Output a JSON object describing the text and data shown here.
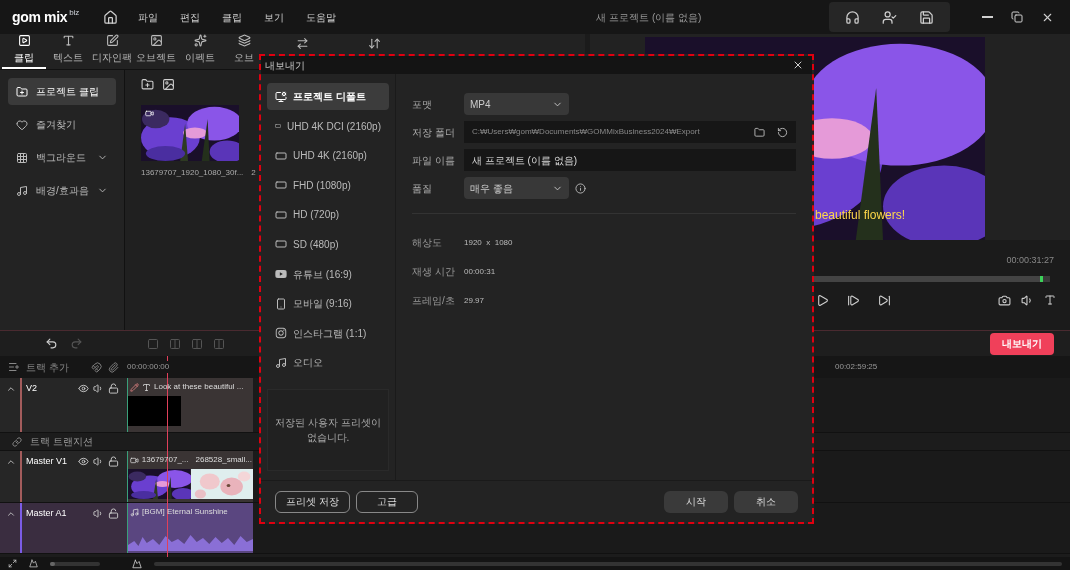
{
  "app": {
    "logo": "gom mix",
    "logo_sup": "biz",
    "menu": [
      "파일",
      "편집",
      "클립",
      "보기",
      "도움말"
    ],
    "title": "새 프로젝트 (이름 없음)"
  },
  "tool_tabs": [
    {
      "label": "클립",
      "kind": "clip",
      "selected": true
    },
    {
      "label": "텍스트",
      "kind": "text",
      "selected": false
    },
    {
      "label": "디자인팩",
      "kind": "design",
      "selected": false
    },
    {
      "label": "오브젝트",
      "kind": "object",
      "selected": false
    },
    {
      "label": "이펙트",
      "kind": "effect",
      "selected": false
    },
    {
      "label": "오브",
      "kind": "overlay",
      "selected": false
    },
    {
      "kind": "transition",
      "selected": false
    },
    {
      "kind": "swap",
      "selected": false
    }
  ],
  "sidebar": [
    {
      "label": "프로젝트 클립",
      "kind": "folder",
      "selected": true,
      "expandable": false
    },
    {
      "label": "즐겨찾기",
      "kind": "heart",
      "selected": false,
      "expandable": false
    },
    {
      "label": "백그라운드",
      "kind": "texture",
      "selected": false,
      "expandable": true
    },
    {
      "label": "배경/효과음",
      "kind": "music",
      "selected": false,
      "expandable": true
    }
  ],
  "media": {
    "files": [
      {
        "name": "13679707_1920_1080_30f...",
        "kind": "thumb"
      },
      {
        "name": "2",
        "kind": "cut"
      }
    ]
  },
  "preview": {
    "caption": "beautiful flowers!",
    "time": "00:00:31:27",
    "level": 0.985
  },
  "timeline": {
    "zoom": {
      "level": 0.1
    },
    "export_button": "내보내기",
    "add_track": "트랙 추가",
    "start_time": "00:00:00:00",
    "ruler_mark": "00:02:59:25",
    "tracks": [
      {
        "kind": "video",
        "name": "V2",
        "color": "#a35c5c",
        "clips": [
          {
            "kind": "text",
            "label": "Look at these beautiful ..."
          }
        ]
      },
      {
        "kind": "transition",
        "name": "트랙 트랜지션"
      },
      {
        "kind": "video",
        "name": "Master V1",
        "color": "#a35c5c",
        "clips": [
          {
            "kind": "video",
            "label": "13679707_..."
          },
          {
            "kind": "video",
            "label": "268528_small..."
          }
        ]
      },
      {
        "kind": "audio",
        "name": "Master A1",
        "color": "#7b5ce6",
        "clips": [
          {
            "kind": "audio",
            "label": "[BGM] Eternal Sunshine"
          }
        ]
      }
    ]
  },
  "dialog": {
    "title": "내보내기",
    "presets": [
      {
        "label": "프로젝트 디폴트",
        "kind": "project",
        "selected": true
      },
      {
        "label": "UHD 4K DCI (2160p)",
        "kind": "resolution",
        "selected": false
      },
      {
        "label": "UHD 4K (2160p)",
        "kind": "resolution",
        "selected": false
      },
      {
        "label": "FHD (1080p)",
        "kind": "resolution",
        "selected": false
      },
      {
        "label": "HD (720p)",
        "kind": "resolution",
        "selected": false
      },
      {
        "label": "SD (480p)",
        "kind": "resolution",
        "selected": false
      },
      {
        "label": "유튜브 (16:9)",
        "kind": "youtube",
        "selected": false
      },
      {
        "label": "모바일 (9:16)",
        "kind": "mobile",
        "selected": false
      },
      {
        "label": "인스타그램 (1:1)",
        "kind": "instagram",
        "selected": false
      },
      {
        "label": "오디오",
        "kind": "audio",
        "selected": false
      }
    ],
    "user_presets_empty": "저장된 사용자 프리셋이 없습니다.",
    "fields": [
      {
        "label": "포맷",
        "kind": "select",
        "value": "MP4",
        "info": false
      },
      {
        "label": "저장 폴더",
        "kind": "path",
        "value": "C:₩Users₩gom₩Documents₩GOMMixBusiness2024₩Export",
        "info": false
      },
      {
        "label": "파일 이름",
        "kind": "text",
        "value": "새 프로젝트 (이름 없음)",
        "info": false
      },
      {
        "label": "품질",
        "kind": "select",
        "value": "매우 좋음",
        "info": true
      }
    ],
    "info": [
      {
        "label": "해상도",
        "value": "1920  x  1080"
      },
      {
        "label": "재생 시간",
        "value": "00:00:31"
      },
      {
        "label": "프레임/초",
        "value": "29.97"
      }
    ],
    "buttons_left": [
      "프리셋 저장",
      "고급"
    ],
    "buttons_right": [
      "시작",
      "취소"
    ]
  }
}
